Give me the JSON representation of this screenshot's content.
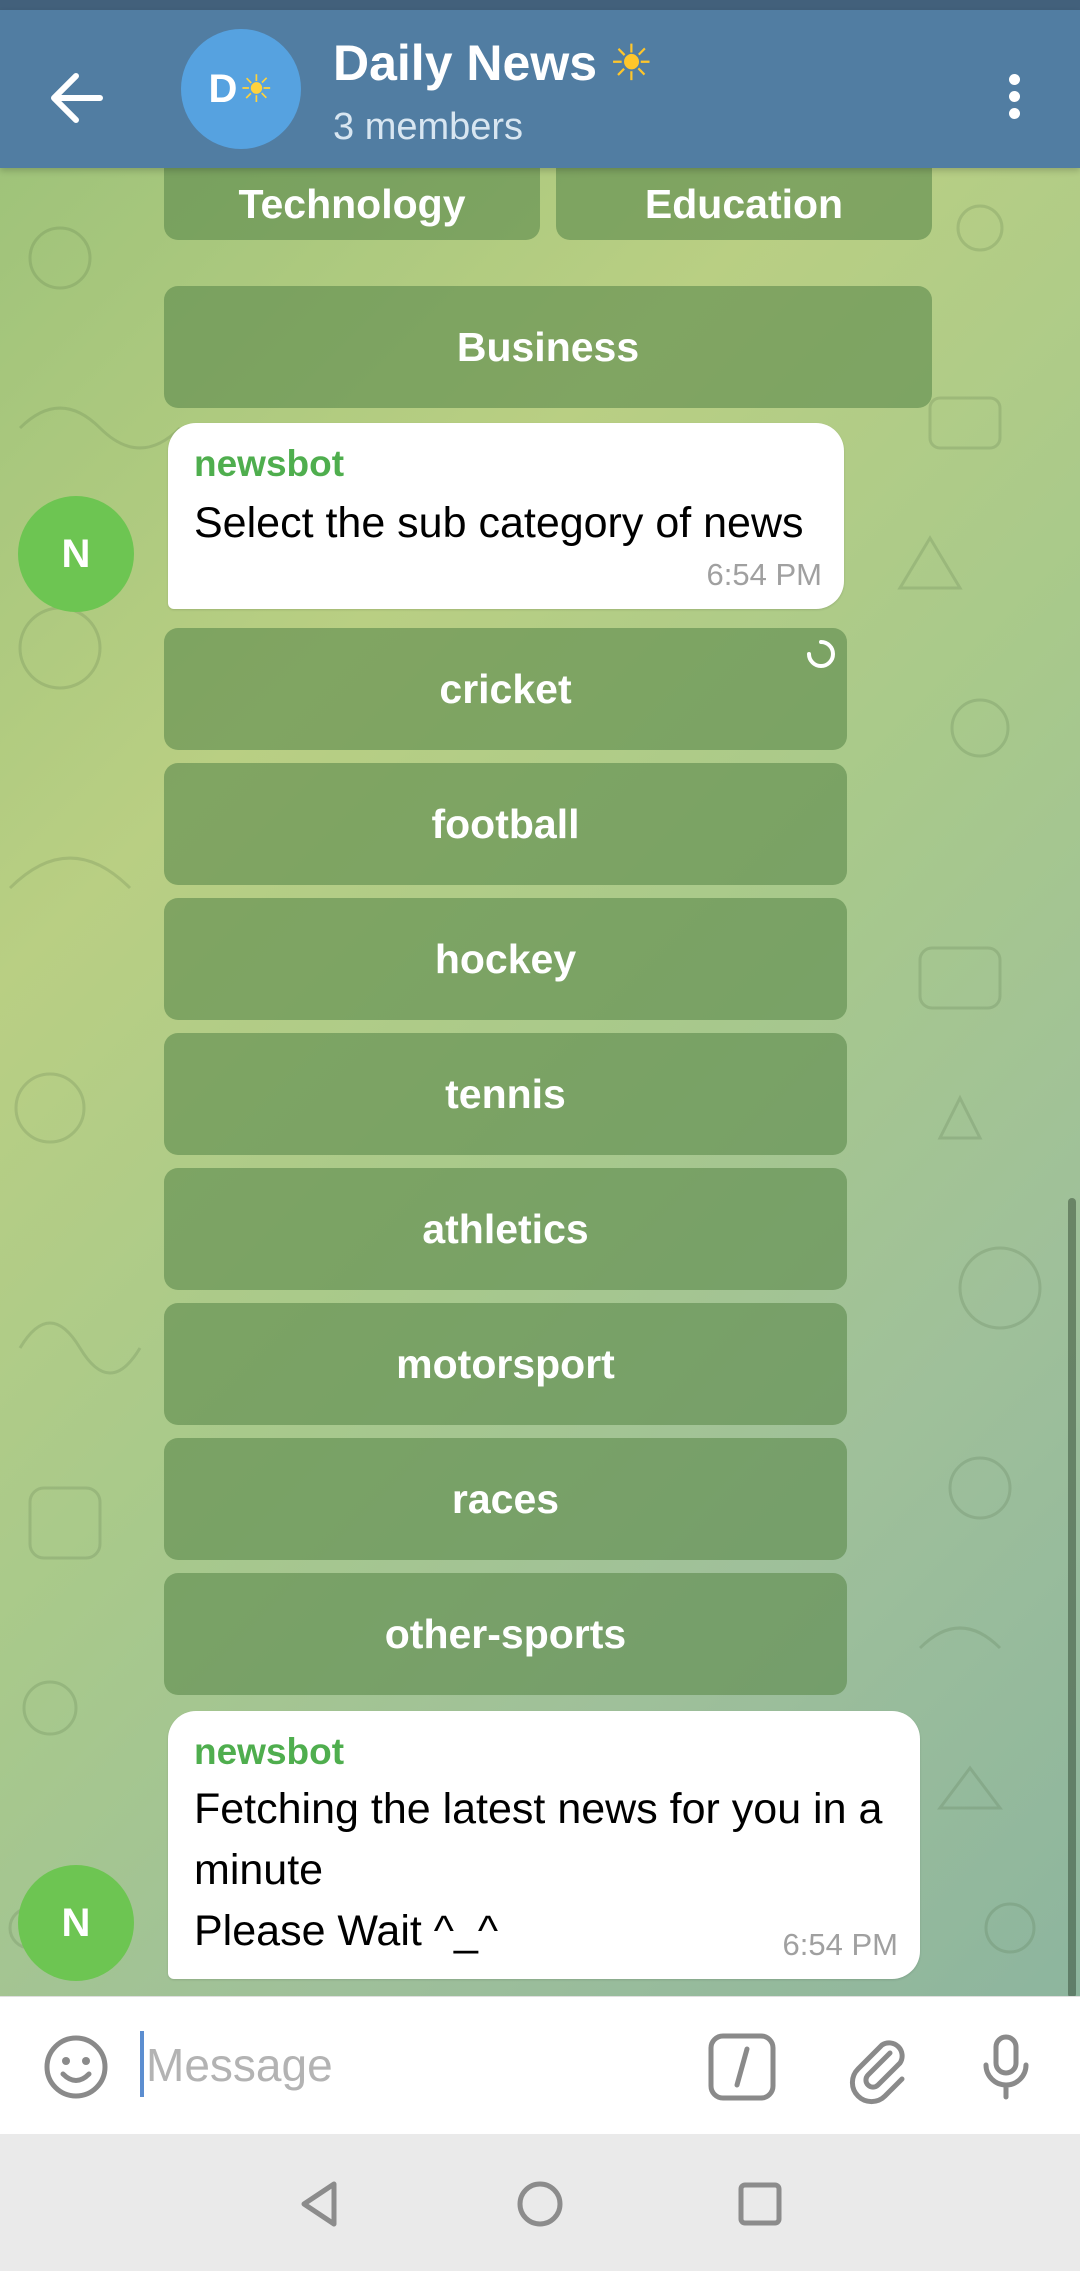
{
  "header": {
    "title": "Daily News",
    "title_emoji": "☀",
    "subtitle": "3 members",
    "avatar_letter": "D",
    "avatar_emoji": "☀"
  },
  "keyboard_top": {
    "row1": [
      "Technology",
      "Education"
    ],
    "row2": [
      "Business"
    ]
  },
  "message1": {
    "sender": "newsbot",
    "text": "Select the sub category of news",
    "time": "6:54 PM",
    "avatar_letter": "N"
  },
  "subcategories": [
    "cricket",
    "football",
    "hockey",
    "tennis",
    "athletics",
    "motorsport",
    "races",
    "other-sports"
  ],
  "message2": {
    "sender": "newsbot",
    "text": "Fetching the latest news for you in a\nminute\nPlease Wait ^_^",
    "time": "6:54 PM",
    "avatar_letter": "N"
  },
  "input": {
    "placeholder": "Message",
    "value": ""
  },
  "icons": {
    "back": "arrow-left-icon",
    "menu": "more-vert-icon",
    "emoji": "smiley-icon",
    "commands": "slash-command-icon",
    "attach": "paperclip-icon",
    "mic": "microphone-icon",
    "loading": "spinner-icon",
    "nav_back": "triangle-back-icon",
    "nav_home": "circle-home-icon",
    "nav_recents": "square-recents-icon"
  },
  "colors": {
    "header": "#517da2",
    "sender_name": "#4fae4e",
    "avatar_bot": "#6dc552",
    "avatar_group": "#56a2e0",
    "keyboard_button": "#5e8a4e"
  }
}
